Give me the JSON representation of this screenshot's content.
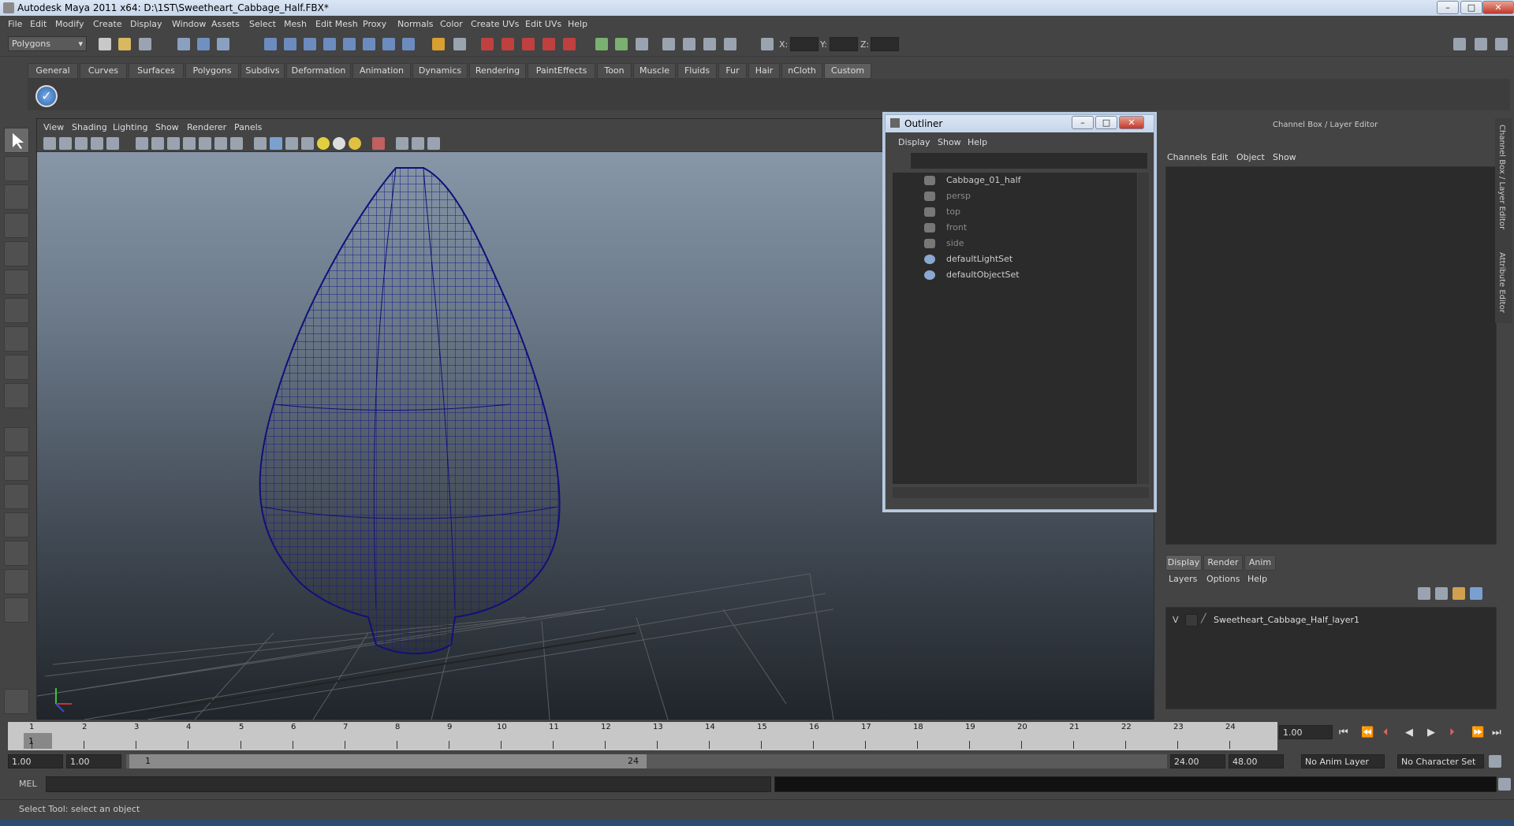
{
  "window": {
    "title": "Autodesk Maya 2011 x64: D:\\1ST\\Sweetheart_Cabbage_Half.FBX*",
    "min": "–",
    "max": "□",
    "close": "✕"
  },
  "menubar": [
    "File",
    "Edit",
    "Modify",
    "Create",
    "Display",
    "Window",
    "Assets",
    "Select",
    "Mesh",
    "Edit Mesh",
    "Proxy",
    "Normals",
    "Color",
    "Create UVs",
    "Edit UVs",
    "Help"
  ],
  "toolbar": {
    "mode": "Polygons",
    "x_label": "X:",
    "y_label": "Y:",
    "z_label": "Z:"
  },
  "shelf_tabs": [
    "General",
    "Curves",
    "Surfaces",
    "Polygons",
    "Subdivs",
    "Deformation",
    "Animation",
    "Dynamics",
    "Rendering",
    "PaintEffects",
    "Toon",
    "Muscle",
    "Fluids",
    "Fur",
    "Hair",
    "nCloth",
    "Custom"
  ],
  "shelf_active": "Custom",
  "viewport": {
    "menu": [
      "View",
      "Shading",
      "Lighting",
      "Show",
      "Renderer",
      "Panels"
    ]
  },
  "outliner": {
    "title": "Outliner",
    "menu": [
      "Display",
      "Show",
      "Help"
    ],
    "items": [
      {
        "label": "Cabbage_01_half",
        "dim": false
      },
      {
        "label": "persp",
        "dim": true
      },
      {
        "label": "top",
        "dim": true
      },
      {
        "label": "front",
        "dim": true
      },
      {
        "label": "side",
        "dim": true
      },
      {
        "label": "defaultLightSet",
        "dim": false
      },
      {
        "label": "defaultObjectSet",
        "dim": false
      }
    ]
  },
  "channelbox": {
    "title": "Channel Box / Layer Editor",
    "menu": [
      "Channels",
      "Edit",
      "Object",
      "Show"
    ],
    "layer_tabs": [
      "Display",
      "Render",
      "Anim"
    ],
    "layer_menu": [
      "Layers",
      "Options",
      "Help"
    ],
    "layer": {
      "visible": "V",
      "name": "Sweetheart_Cabbage_Half_layer1"
    },
    "side_tabs": [
      "Channel Box / Layer Editor",
      "Attribute Editor"
    ]
  },
  "timeslider": {
    "ticks": [
      "1",
      "2",
      "3",
      "4",
      "5",
      "6",
      "7",
      "8",
      "9",
      "10",
      "11",
      "12",
      "13",
      "14",
      "15",
      "16",
      "17",
      "18",
      "19",
      "20",
      "21",
      "22",
      "23",
      "24"
    ],
    "current": "1",
    "current_frame": "1.00"
  },
  "rangeslider": {
    "start": "1.00",
    "inner_start": "1.00",
    "range_start": "1",
    "range_end": "24",
    "end": "24.00",
    "max": "48.00",
    "anim_layer": "No Anim Layer",
    "char_set": "No Character Set"
  },
  "cmd": {
    "label": "MEL"
  },
  "help": {
    "text": "Select Tool: select an object"
  }
}
